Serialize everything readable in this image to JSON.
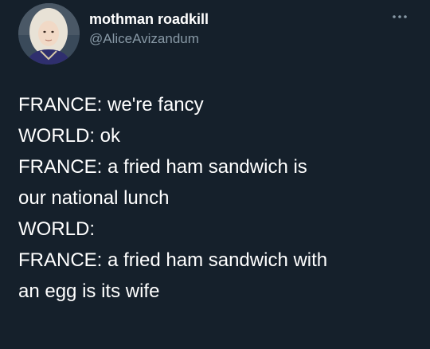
{
  "author": {
    "display_name": "mothman roadkill",
    "handle": "@AliceAvizandum"
  },
  "more_icon": "more-horizontal-icon",
  "tweet": {
    "lines": [
      "FRANCE: we're fancy",
      "WORLD: ok",
      "FRANCE: a fried ham sandwich is",
      "our national lunch",
      "WORLD:",
      "FRANCE: a fried ham sandwich with",
      "an egg is its wife"
    ]
  },
  "colors": {
    "background": "#15202b",
    "primary_text": "#ffffff",
    "secondary_text": "#8899a6"
  }
}
